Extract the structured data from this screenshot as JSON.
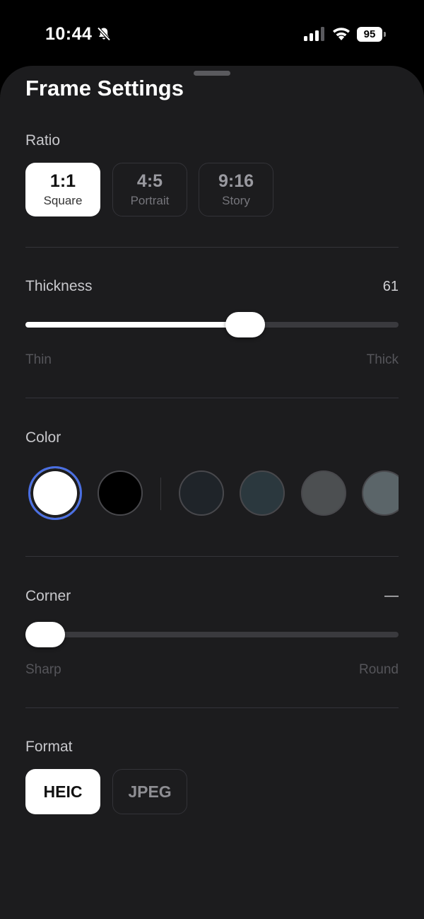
{
  "status_bar": {
    "time": "10:44",
    "battery_level": "95"
  },
  "sheet": {
    "title": "Frame Settings"
  },
  "ratio": {
    "label": "Ratio",
    "options": [
      {
        "main": "1:1",
        "sub": "Square",
        "selected": true
      },
      {
        "main": "4:5",
        "sub": "Portrait",
        "selected": false
      },
      {
        "main": "9:16",
        "sub": "Story",
        "selected": false
      }
    ]
  },
  "thickness": {
    "label": "Thickness",
    "value": "61",
    "fraction": 0.6,
    "min_label": "Thin",
    "max_label": "Thick"
  },
  "color": {
    "label": "Color",
    "swatches": [
      {
        "name": "white",
        "hex": "#ffffff",
        "selected": true
      },
      {
        "name": "black",
        "hex": "#000000",
        "selected": false
      },
      {
        "name": "charcoal",
        "hex": "#1f2429",
        "selected": false
      },
      {
        "name": "slate",
        "hex": "#2b383e",
        "selected": false
      },
      {
        "name": "gray",
        "hex": "#4c4f51",
        "selected": false
      },
      {
        "name": "blue-gray",
        "hex": "#5b6569",
        "selected": false
      }
    ],
    "selection_ring": "#4a6fe3"
  },
  "corner": {
    "label": "Corner",
    "value": "—",
    "fraction": 0.0,
    "min_label": "Sharp",
    "max_label": "Round"
  },
  "format": {
    "label": "Format",
    "options": [
      {
        "label": "HEIC",
        "selected": true
      },
      {
        "label": "JPEG",
        "selected": false
      }
    ]
  }
}
